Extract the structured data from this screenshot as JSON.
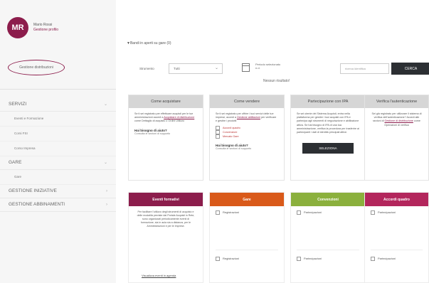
{
  "user": {
    "initials": "MR",
    "name": "Mario Rossi",
    "sub": "Gestione profilo"
  },
  "gestione_label": "Gestione distribuzioni",
  "nav": [
    {
      "type": "sec",
      "label": "SERVIZI"
    },
    {
      "type": "sub",
      "label": "Eventi e Formazione"
    },
    {
      "type": "sub",
      "label": "Corsi FSI"
    },
    {
      "type": "sub",
      "label": "Corso Impresa"
    },
    {
      "type": "sec",
      "label": "GARE"
    },
    {
      "type": "sub",
      "label": "Gare"
    },
    {
      "type": "sec",
      "label": "GESTIONE INIZIATIVE"
    },
    {
      "type": "sec",
      "label": "GESTIONE ABBINAMENTI"
    }
  ],
  "breadcrumb": "Bandi in aperti su gare (0)",
  "filters": {
    "label": "Strumento",
    "select_value": "Tutti",
    "periodo_line1": "Periodo selezionato",
    "periodo_line2": "n.d.",
    "nessun": "Nessun risultato!",
    "search_placeholder": "ricerca identifica",
    "cerca_label": "CERCA"
  },
  "cards": [
    {
      "title": "Come acquistare",
      "text": "Se ti sei registrato per effettuare acquisti per le tue amministrazioni accedi a",
      "link": "Acquistare di distribuzione",
      "text2": "come Dettaglio di acquisto o Ordini Utilizzo",
      "q": "Hai bisogno di aiuto?",
      "qs": "Consulta le sezioni di supporto"
    },
    {
      "title": "Come vendere",
      "text": "Se ti sei registrato per offrire i tuoi servizi delle tue imprese, accedi a",
      "link": "Gestione abilitazioni",
      "text2": "per verificare e gestire i prodotti",
      "list": [
        "Accordi quadro",
        "Convenzioni",
        "Mercato Gare"
      ],
      "q": "Hai bisogno di aiuto?",
      "qs": "Consulta le sezioni di supporto"
    },
    {
      "title": "Partecipazione con IPA",
      "text": "Se sei utente del Sistema Acquisti, entra nella piattaforma per gestire i tuoi acquisti con IPA e partecipa agli strumenti di negoziazione e abilitazione attiva. Se hai bisogno di IPA di una tua amministrazione, verifica la procedura per trasferire ai partecipanti i dati di identità principali attive.",
      "button": "SELEZIONA"
    },
    {
      "title": "Verifica l'autenticazione",
      "text": "Sei già registrato per utilizzare il sistema di verifica dell'autenticazione? Accedi alle sezioni di",
      "link": "Gestione di distribuzione",
      "text2": "come Operazioni di verifica"
    }
  ],
  "panels": [
    {
      "title": "Eventi formativi",
      "color": "#8c1d4c",
      "text": "Per facilitare l'utilizzo degli strumenti di acquisto e delle modalità previste dal Portale Acquisti in Rete, sono organizzati periodicamente eventi di formazione, sia in aula sia a distanza, per le Amministrazioni e per le Imprese.",
      "link": "Visualizza eventi in agenda"
    },
    {
      "title": "Gare",
      "color": "#d95a1a",
      "item1": "Registrazioni",
      "item2": "Registrazioni"
    },
    {
      "title": "Convenzioni",
      "color": "#8bb03d",
      "item1": "Partecipazioni",
      "item2": "Partecipazioni"
    },
    {
      "title": "Accordi quadro",
      "color": "#b3265c",
      "item1": "Partecipazioni",
      "item2": "Partecipazioni"
    }
  ]
}
